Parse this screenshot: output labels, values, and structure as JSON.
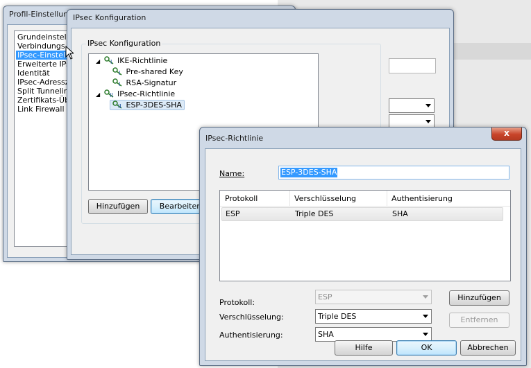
{
  "back_window": {
    "title": "Profil-Einstellungen",
    "nav_items": [
      "Grundeinstellu",
      "Verbindungs",
      "IPsec-Einstellu",
      "Erweiterte IPse",
      "Identität",
      "IPsec-Adresszu",
      "Split Tunneling",
      "Zertifikats-Übe",
      "Link Firewall"
    ],
    "selected_index": 2
  },
  "mid_window": {
    "title": "IPsec Konfiguration",
    "group_label": "IPsec Konfiguration",
    "tree": {
      "ike_label": "IKE-Richtlinie",
      "ike_children": [
        "Pre-shared Key",
        "RSA-Signatur"
      ],
      "ipsec_label": "IPsec-Richtlinie",
      "ipsec_children": [
        "ESP-3DES-SHA"
      ]
    },
    "buttons": {
      "add": "Hinzufügen",
      "edit": "Bearbeiten"
    }
  },
  "dialog": {
    "title": "IPsec-Richtlinie",
    "close_glyph": "x",
    "name_label": "Name:",
    "name_value": "ESP-3DES-SHA",
    "table": {
      "columns": [
        "Protokoll",
        "Verschlüsselung",
        "Authentisierung"
      ],
      "rows": [
        [
          "ESP",
          "Triple DES",
          "SHA"
        ]
      ]
    },
    "fields": {
      "protocol_label": "Protokoll:",
      "protocol_value": "ESP",
      "encryption_label": "Verschlüsselung:",
      "encryption_value": "Triple DES",
      "auth_label": "Authentisierung:",
      "auth_value": "SHA"
    },
    "buttons": {
      "add": "Hinzufügen",
      "remove": "Entfernen",
      "help": "Hilfe",
      "ok": "OK",
      "cancel": "Abbrechen"
    }
  },
  "colors": {
    "selection": "#3399ff",
    "title_bar": "#cfd9e6",
    "close_red": "#c8442a"
  }
}
